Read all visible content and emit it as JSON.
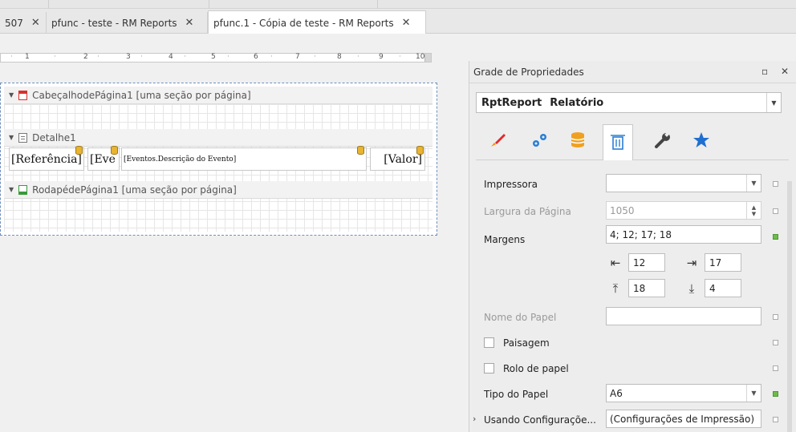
{
  "tabs": [
    {
      "label": "507",
      "close": "✕"
    },
    {
      "label": "pfunc - teste - RM Reports",
      "close": "✕"
    },
    {
      "label": "pfunc.1 - Cópia de teste - RM Reports",
      "close": "✕"
    }
  ],
  "ruler": {
    "marks": [
      "1",
      "2",
      "3",
      "4",
      "5",
      "6",
      "7",
      "8",
      "9",
      "10"
    ]
  },
  "report": {
    "bands": [
      {
        "label": "CabeçalhodePágina1 [uma seção por página]",
        "icon": "page-header-icon",
        "color": "#d9302c"
      },
      {
        "label": "Detalhe1",
        "icon": "detail-band-icon",
        "color": "#7a8aa0"
      },
      {
        "label": "RodapédePágina1 [uma seção por página]",
        "icon": "page-footer-icon",
        "color": "#3a9a3a"
      }
    ],
    "detail_cells": [
      "[Referência]",
      "[Eve",
      "[Eventos.Descrição do Evento]",
      "[Valor]"
    ]
  },
  "properties": {
    "title": "Grade de Propriedades",
    "controls": {
      "float": "▫",
      "close": "✕"
    },
    "object_name": "RptReport",
    "object_type": "Relatório",
    "tab_icons": [
      "brush-icon",
      "gears-icon",
      "database-icon",
      "layout-icon",
      "wrench-icon",
      "star-icon"
    ],
    "rows": {
      "impressora": {
        "label": "Impressora",
        "value": ""
      },
      "largura": {
        "label": "Largura da Página",
        "value": "1050"
      },
      "margens": {
        "label": "Margens",
        "value": "4; 12; 17; 18",
        "left": "12",
        "right": "17",
        "top": "18",
        "bottom": "4"
      },
      "nome_papel": {
        "label": "Nome do Papel",
        "value": ""
      },
      "paisagem": {
        "label": "Paisagem"
      },
      "rolo": {
        "label": "Rolo de papel"
      },
      "tipo_papel": {
        "label": "Tipo do Papel",
        "value": "A6"
      },
      "usando": {
        "label": "Usando Configuraçõe...",
        "value": "(Configurações de Impressão)"
      }
    }
  }
}
